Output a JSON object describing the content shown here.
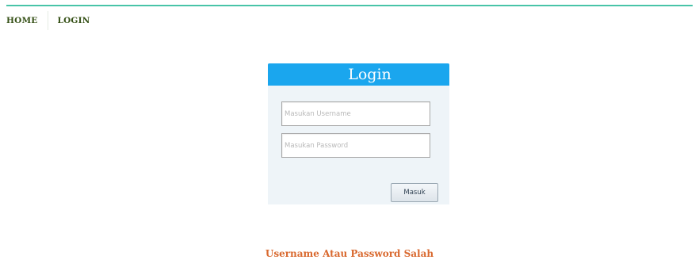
{
  "nav": {
    "items": [
      {
        "label": "HOME"
      },
      {
        "label": "LOGIN"
      }
    ]
  },
  "login": {
    "title": "Login",
    "username_placeholder": "Masukan Username",
    "username_value": "",
    "password_placeholder": "Masukan Password",
    "password_value": "",
    "submit_label": "Masuk"
  },
  "error": {
    "message": "Username Atau Password Salah"
  },
  "colors": {
    "accent_border": "#49c4a8",
    "header_bg": "#1aa6ee",
    "box_bg": "#eef4f8",
    "nav_text": "#355016",
    "error_text": "#d9692f"
  }
}
